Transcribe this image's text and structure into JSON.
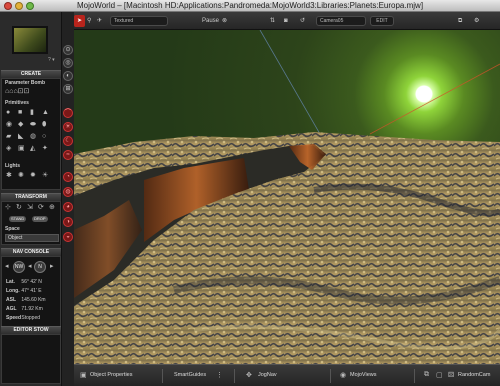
{
  "window": {
    "title": "MojoWorld – [Macintosh HD:Applications:Pandromeda:MojoWorld3:Libraries:Planets:Europa.mjw]"
  },
  "left_panel": {
    "thumb_label": "? ▾",
    "create": {
      "header": "CREATE",
      "parameter_bomb": "Parameter Bomb",
      "primitives": "Primitives",
      "lights": "Lights"
    },
    "transform": {
      "header": "TRANSFORM",
      "stand": "STAND",
      "drop": "DROP",
      "space_label": "Space",
      "space_value": "Object"
    },
    "nav_console": {
      "header": "NAV CONSOLE",
      "nw": "NW",
      "n": "N",
      "rows": [
        {
          "key": "Lat.",
          "value": "56° 42' N"
        },
        {
          "key": "Long.",
          "value": "47° 41' E"
        },
        {
          "key": "ASL",
          "value": "145.60 Km"
        },
        {
          "key": "AGL",
          "value": "71.92 Km"
        },
        {
          "key": "Speed",
          "value": "Stopped"
        }
      ]
    },
    "editor_stow": {
      "header": "EDITOR STOW"
    }
  },
  "toolbar": {
    "render_mode": "Textured",
    "pause": "Pause",
    "camera": "Camera05",
    "edit": "EDIT"
  },
  "bottom_bar": {
    "object_properties": "Object Properties",
    "smart_guides": "SmartGuides",
    "jog_nav": "JogNav",
    "mojo_views": "MojoViews",
    "random_cam": "RandomCam"
  },
  "colors": {
    "sun_glow": "#8fd43a",
    "active_tool": "#b8241c",
    "terrain_light": "#d9c07a",
    "terrain_dark": "#2b3040",
    "cliff": "#c76a2a"
  }
}
